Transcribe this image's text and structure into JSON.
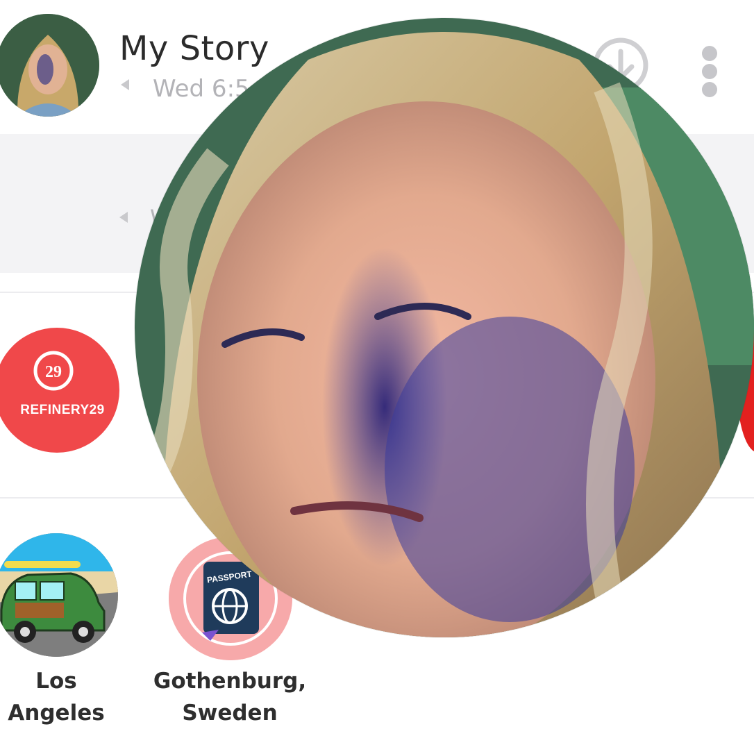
{
  "header": {
    "title": "My Story",
    "subtitle": "Wed 6:5",
    "avatar_icon": "user-avatar-icon",
    "download_icon": "download-icon",
    "more_icon": "more-vertical-icon"
  },
  "panel": {
    "text": "W"
  },
  "discover": {
    "refinery": {
      "label": "REFINERY29",
      "logo_text": "29",
      "color": "#f0484a"
    }
  },
  "stories": [
    {
      "label_line1": "Los",
      "label_line2": "Angeles"
    },
    {
      "label_line1": "Gothenburg,",
      "label_line2": "Sweden",
      "badge": "PASSPORT"
    }
  ],
  "colors": {
    "accent_red": "#f0484a",
    "edge_red": "#e3211f",
    "muted_text": "#b3b3b7",
    "panel_bg": "#f3f3f5"
  }
}
